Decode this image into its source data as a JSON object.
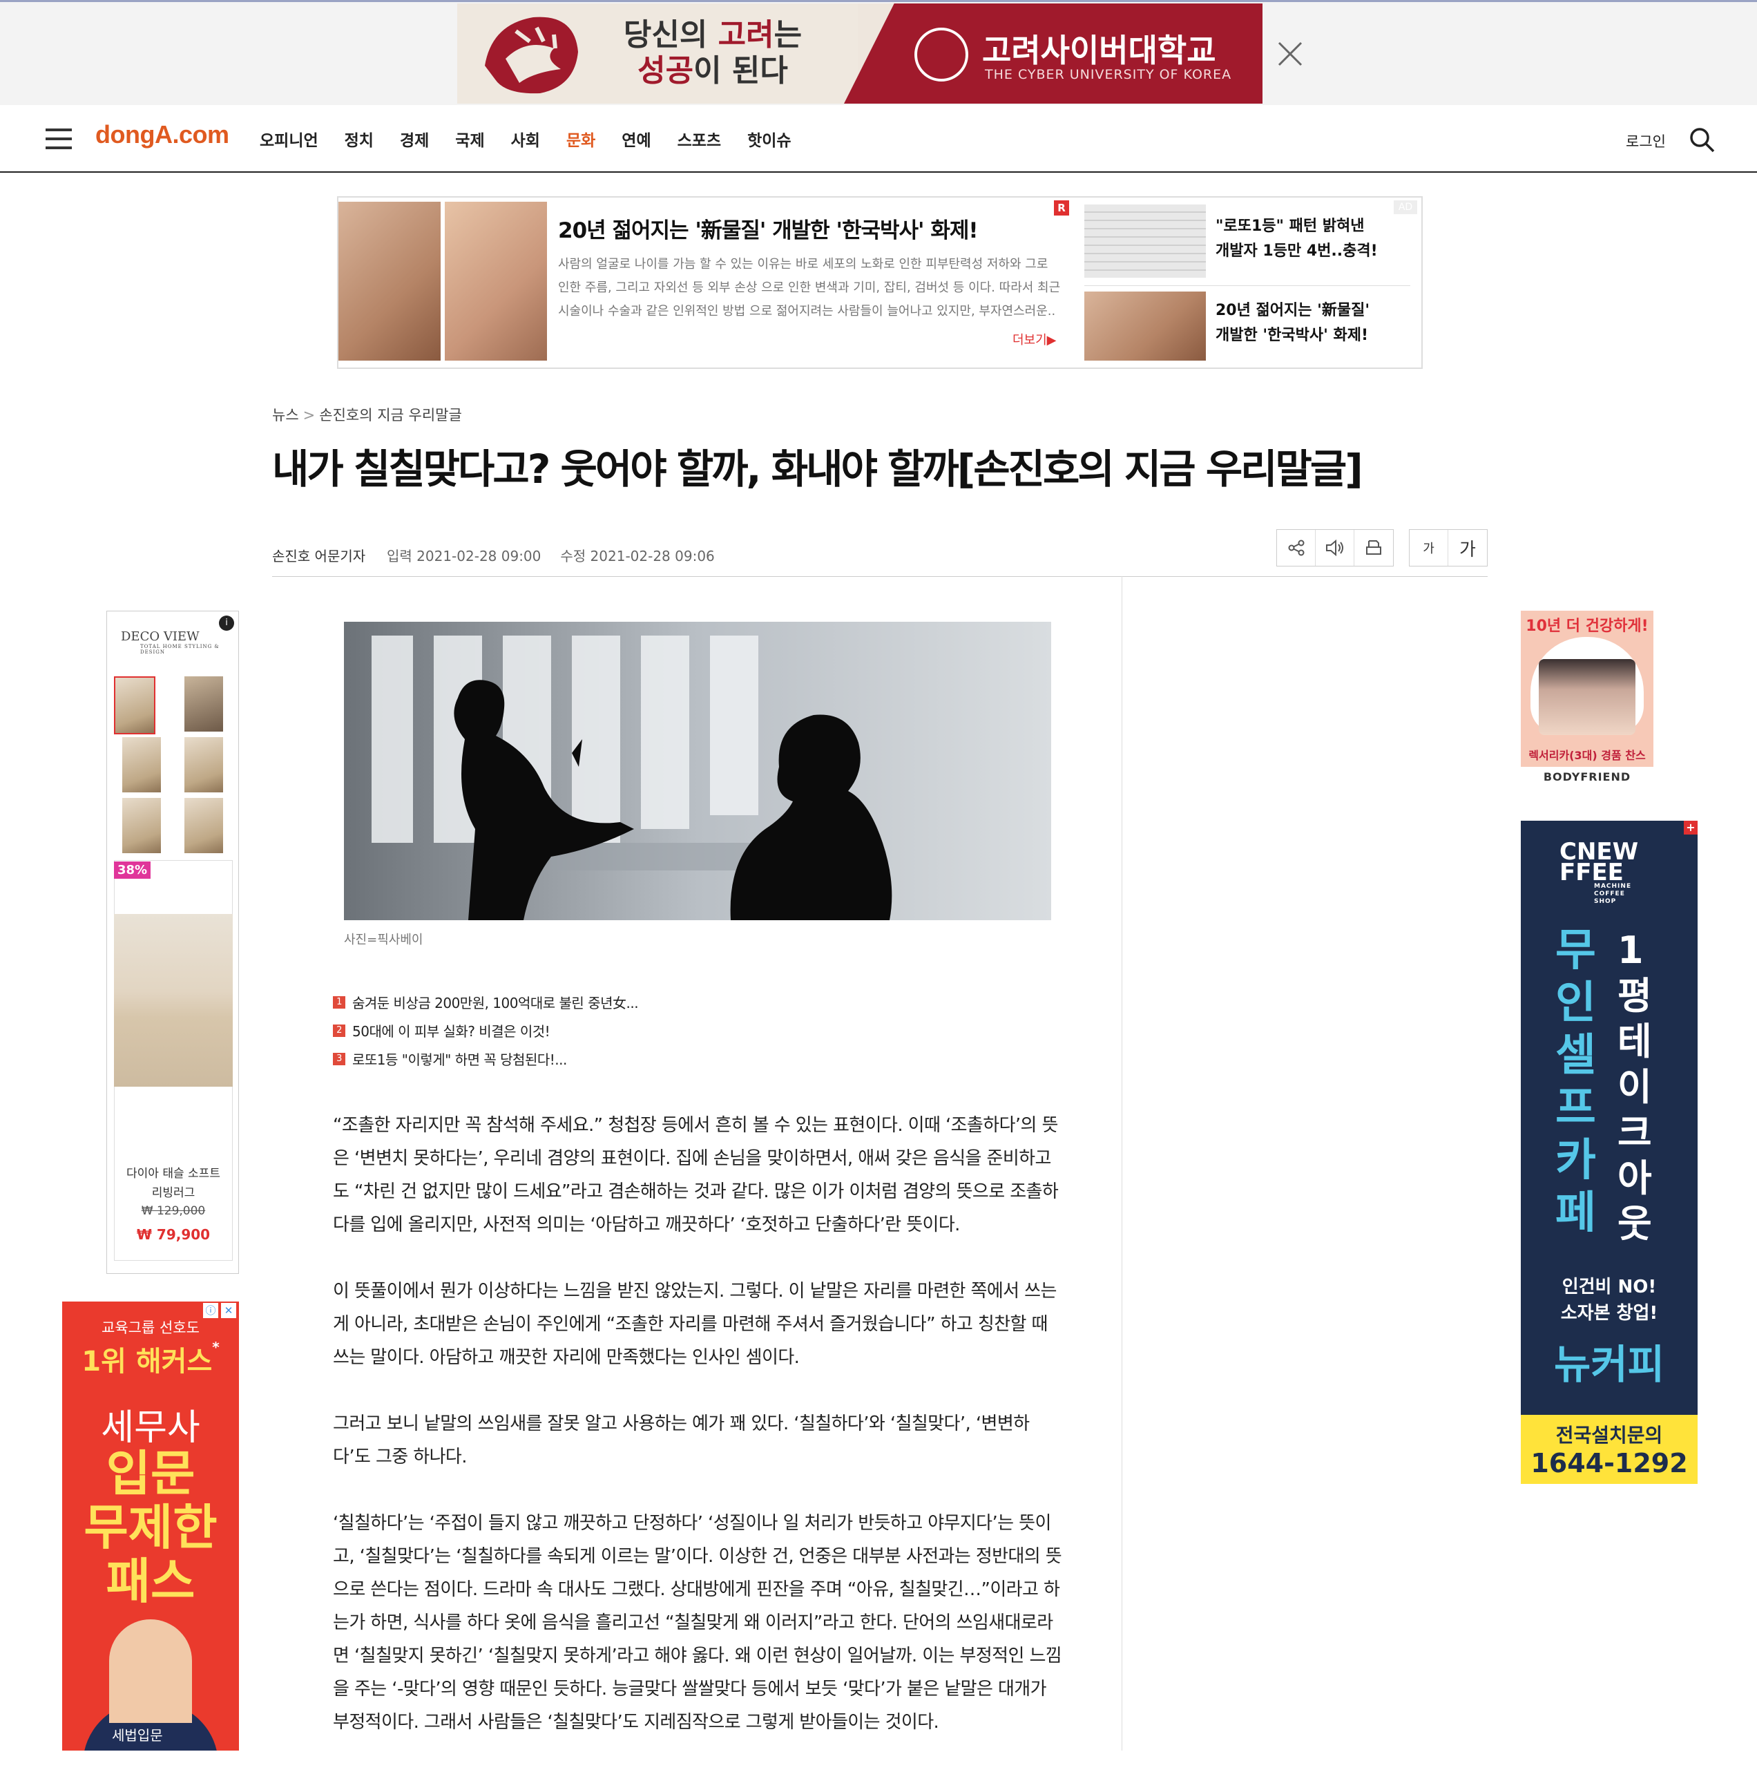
{
  "top_ad": {
    "slogan_line1_pre": "당신의 ",
    "slogan_line1_red": "고려",
    "slogan_line1_post": "는",
    "slogan_line2_red": "성공",
    "slogan_line2_post": "이 된다",
    "university": "고려사이버대학교",
    "university_en": "THE CYBER UNIVERSITY OF KOREA"
  },
  "nav": {
    "logo": "dongA.com",
    "items": [
      "오피니언",
      "정치",
      "경제",
      "국제",
      "사회",
      "문화",
      "연예",
      "스포츠",
      "핫이슈"
    ],
    "active_index": 5,
    "login": "로그인",
    "active_color": "#e05a20"
  },
  "mid_ad": {
    "headline": "20년 젊어지는 '新물질' 개발한 '한국박사' 화제!",
    "body": "사람의 얼굴로 나이를 가늠 할 수 있는 이유는 바로 세포의 노화로 인한 피부탄력성 저하와 그로 인한 주름, 그리고 자외선 등 외부 손상 으로 인한 변색과 기미, 잡티, 검버섯 등 이다. 따라서 최근 시술이나 수술과 같은 인위적인 방법 으로 젊어지려는 사람들이 늘어나고 있지만, 부자연스러운..",
    "more": "더보기▶",
    "r_badge": "R",
    "ad_badge": "AD",
    "side1": "\"로또1등\" 패턴 밝혀낸 개발자 1등만 4번..충격!",
    "side2": "20년 젊어지는 '新물질' 개발한 '한국박사' 화제!"
  },
  "article": {
    "breadcrumb": [
      "뉴스",
      "손진호의 지금 우리말글"
    ],
    "breadcrumb_sep": ">",
    "title": "내가 칠칠맞다고? 웃어야 할까, 화내야 할까[손진호의 지금 우리말글]",
    "byline": "손진호 어문기자",
    "input_date": "입력 2021-02-28 09:00",
    "modified_date": "수정 2021-02-28 09:06",
    "font_small": "가",
    "font_large": "가",
    "photo_caption": "사진=픽사베이",
    "related": [
      {
        "num": "1",
        "text": "숨겨둔 비상금 200만원, 100억대로 불린 중년女..."
      },
      {
        "num": "2",
        "text": "50대에 이 피부 실화? 비결은 이것!"
      },
      {
        "num": "3",
        "text": "로또1등 \"이렇게\" 하면 꼭 당첨된다!..."
      }
    ],
    "paragraphs": [
      "“조촐한 자리지만 꼭 참석해 주세요.” 청첩장 등에서 흔히 볼 수 있는 표현이다. 이때 ‘조촐하다’의 뜻은 ‘변변치 못하다는’, 우리네 겸양의 표현이다. 집에 손님을 맞이하면서, 애써 갖은 음식을 준비하고도 “차린 건 없지만 많이 드세요”라고 겸손해하는 것과 같다. 많은 이가 이처럼 겸양의 뜻으로 조촐하다를 입에 올리지만, 사전적 의미는 ‘아담하고 깨끗하다’ ‘호젓하고 단출하다’란 뜻이다.",
      "이 뜻풀이에서 뭔가 이상하다는 느낌을 받진 않았는지. 그렇다. 이 낱말은 자리를 마련한 쪽에서 쓰는 게 아니라, 초대받은 손님이 주인에게 “조촐한 자리를 마련해 주셔서 즐거웠습니다” 하고 칭찬할 때 쓰는 말이다. 아담하고 깨끗한 자리에 만족했다는 인사인 셈이다.",
      "그러고 보니 낱말의 쓰임새를 잘못 알고 사용하는 예가 꽤 있다. ‘칠칠하다’와 ‘칠칠맞다’, ‘변변하다’도 그중 하나다.",
      "‘칠칠하다’는 ‘주접이 들지 않고 깨끗하고 단정하다’ ‘성질이나 일 처리가 반듯하고 야무지다’는 뜻이고, ‘칠칠맞다’는 ‘칠칠하다를 속되게 이르는 말’이다. 이상한 건, 언중은 대부분 사전과는 정반대의 뜻으로 쓴다는 점이다. 드라마 속 대사도 그랬다. 상대방에게 핀잔을 주며 “아유, 칠칠맞긴…”이라고 하는가 하면, 식사를 하다 옷에 음식을 흘리고선 “칠칠맞게 왜 이러지”라고 한다. 단어의 쓰임새대로라면 ‘칠칠맞지 못하긴’ ‘칠칠맞지 못하게’라고 해야 옳다. 왜 이런 현상이 일어날까. 이는 부정적인 느낌을 주는 ‘-맞다’의 영향 때문인 듯하다. 능글맞다 쌀쌀맞다 등에서 보듯 ‘맞다’가 붙은 낱말은 대개가 부정적이다. 그래서 사람들은 ‘칠칠맞다’도 지레짐작으로 그렇게 받아들이는 것이다."
    ]
  },
  "left_ads": {
    "deco_brand": "DECO VIEW",
    "deco_brand_sub": "TOTAL HOME STYLING & DESIGN",
    "deco_info": "i",
    "discount": "38%",
    "product_name": "다이아 태슬 소프트 리빙러그",
    "old_price": "₩ 129,000",
    "new_price": "₩ 79,900",
    "hackers_t1": "교육그룹 선호도",
    "hackers_t2": "1위 해커스",
    "hackers_star": "*",
    "hackers_t3": "세무사",
    "hackers_t4a": "입문",
    "hackers_t4b": "무제한",
    "hackers_t4c": "패스",
    "hackers_badge": "세법입문",
    "hackers_icons": [
      "ⓘ",
      "✕"
    ]
  },
  "right_ads": {
    "bf_title": "10년 더 건강하게!",
    "bf_sub": "렉서리카(3대) 경품 찬스",
    "bf_brand": "BODYFRIEND",
    "nc_logo": "CNEW FFEE",
    "nc_logo_sub": "MACHINE COFFEE SHOP",
    "nc_plus": "+",
    "nc_v1": "무인셀프카페",
    "nc_v2": "1평테이크아웃",
    "nc_s1a": "인건비 NO!",
    "nc_s1b": "소자본 창업!",
    "nc_s2": "뉴커피",
    "nc_foot1": "전국설치문의",
    "nc_foot2": "1644-1292"
  }
}
